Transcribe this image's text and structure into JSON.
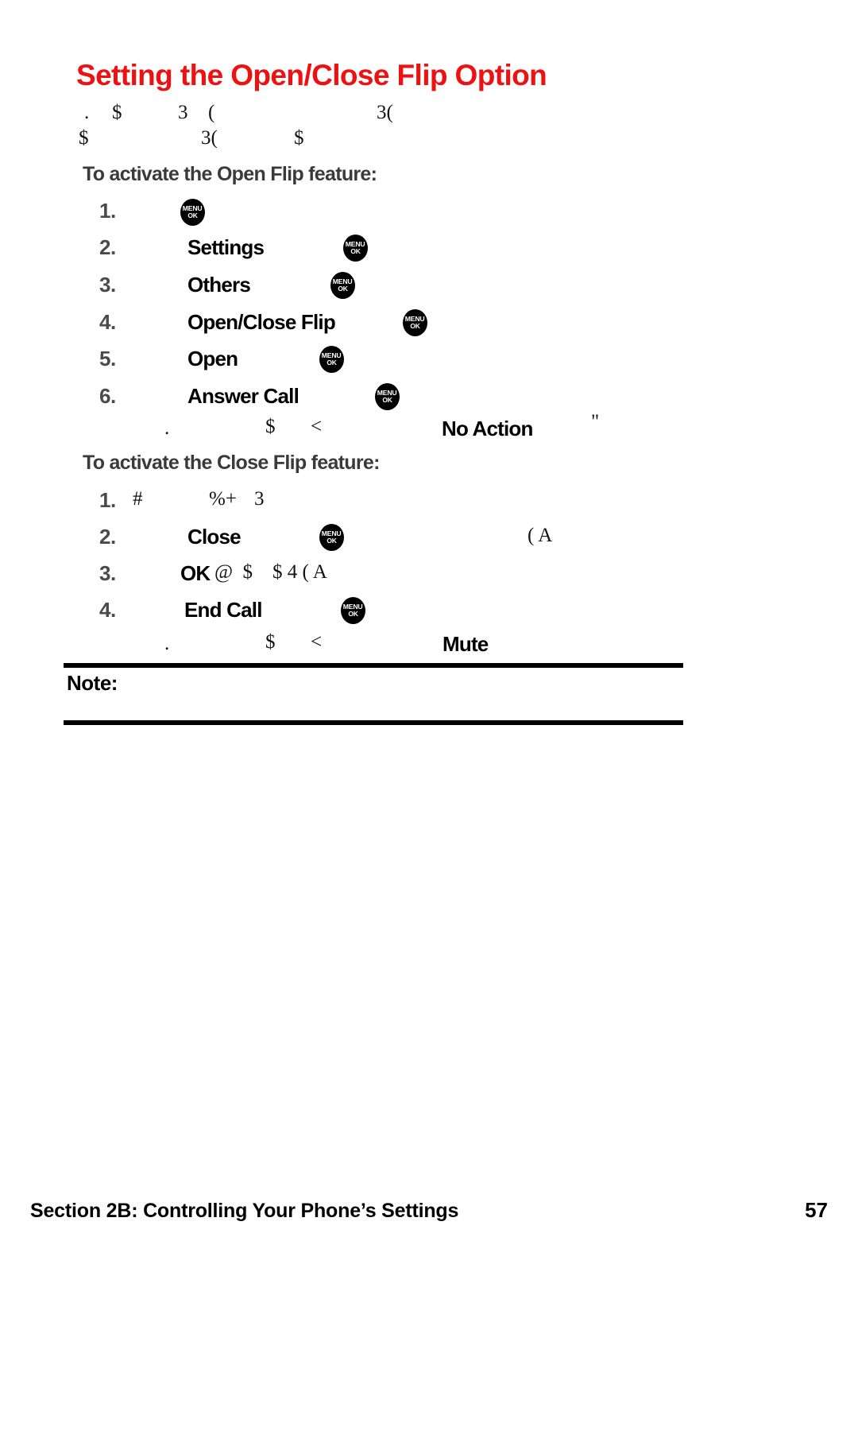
{
  "page": {
    "title": "Setting the Open/Close Flip Option",
    "title_color": "#ee1111",
    "background": "#ffffff"
  },
  "intro": {
    "line1_a": ".",
    "line1_b": "$",
    "line1_c": "3",
    "line1_d": "(",
    "line1_e": "3(",
    "line2_a": "$",
    "line2_b": "3(",
    "line2_c": "$"
  },
  "open_flip": {
    "heading": "To activate the Open Flip feature:",
    "steps": [
      {
        "number": "1.",
        "term": "",
        "icon": "menu-ok-icon",
        "trailing": ""
      },
      {
        "number": "2.",
        "term": "Settings",
        "icon": "menu-ok-icon",
        "trailing": ""
      },
      {
        "number": "3.",
        "term": "Others",
        "icon": "menu-ok-icon",
        "trailing": ""
      },
      {
        "number": "4.",
        "term": "Open/Close Flip",
        "icon": "menu-ok-icon",
        "trailing": ""
      },
      {
        "number": "5.",
        "term": "Open",
        "icon": "menu-ok-icon",
        "trailing": ""
      },
      {
        "number": "6.",
        "term": "Answer Call",
        "icon": "menu-ok-icon",
        "trailing": ""
      }
    ],
    "tip_a": ".",
    "tip_b": "$",
    "tip_c": "<",
    "tip_term": "No Action",
    "tip_d": "\""
  },
  "close_flip": {
    "heading": "To activate the Close Flip feature:",
    "steps": [
      {
        "number": "1.",
        "enc_a": "#",
        "enc_b": "%+",
        "enc_c": "3",
        "term": "",
        "icon": "",
        "trailing": ""
      },
      {
        "number": "2.",
        "enc_a": "",
        "enc_b": "",
        "enc_c": "",
        "term": "Close",
        "icon": "menu-ok-icon",
        "trailing": "( A"
      },
      {
        "number": "3.",
        "enc_a": "",
        "enc_b": "",
        "enc_c": "",
        "term": "OK",
        "icon": "",
        "trailing": "@  $    $ 4 ( A"
      },
      {
        "number": "4.",
        "enc_a": "",
        "enc_b": "",
        "enc_c": "",
        "term": "End Call",
        "icon": "menu-ok-icon",
        "trailing": ""
      }
    ],
    "tip_a": ".",
    "tip_b": "$",
    "tip_c": "<",
    "tip_term": "Mute"
  },
  "note": {
    "label": "Note:"
  },
  "footer": {
    "section": "Section 2B: Controlling Your Phone’s Settings",
    "page_number": "57"
  },
  "icons": {
    "menu_ok": {
      "top": "MENU",
      "bottom": "OK"
    }
  }
}
